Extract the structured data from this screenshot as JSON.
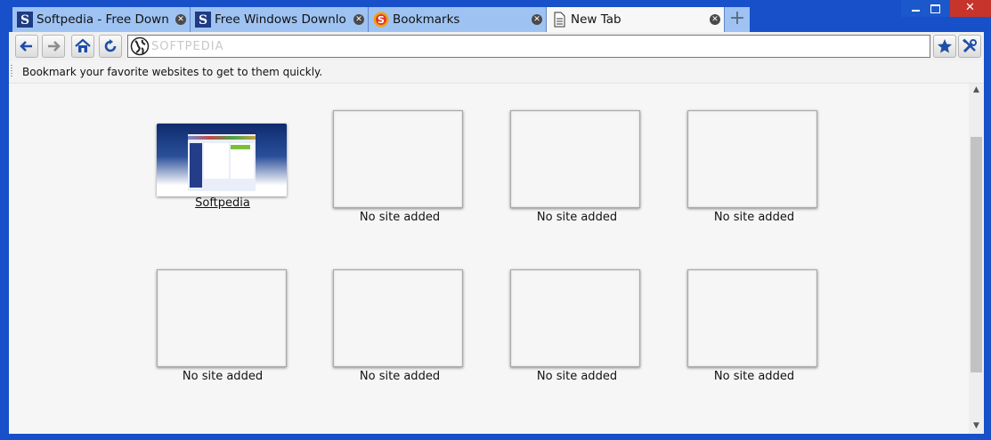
{
  "tabs": [
    {
      "title": "Softpedia - Free Downl…",
      "favicon": "softpedia-s-icon"
    },
    {
      "title": "Free Windows Downloa…",
      "favicon": "softpedia-s-icon"
    },
    {
      "title": "Bookmarks",
      "favicon": "bookmarks-icon"
    },
    {
      "title": "New Tab",
      "favicon": "page-icon"
    }
  ],
  "new_tab_symbol": "+",
  "address": {
    "value": "",
    "watermark": "SOFTPEDIA"
  },
  "bookmarks_bar": {
    "message": "Bookmark your favorite websites to get to them quickly."
  },
  "speed_dial": {
    "tiles": [
      {
        "label": "Softpedia"
      },
      {
        "label": "No site added"
      },
      {
        "label": "No site added"
      },
      {
        "label": "No site added"
      },
      {
        "label": "No site added"
      },
      {
        "label": "No site added"
      },
      {
        "label": "No site added"
      },
      {
        "label": "No site added"
      }
    ]
  },
  "colors": {
    "frame": "#1750c8",
    "tab": "#9ec3f3",
    "active_tab": "#f7f7f7",
    "accent": "#1d4fa8"
  }
}
